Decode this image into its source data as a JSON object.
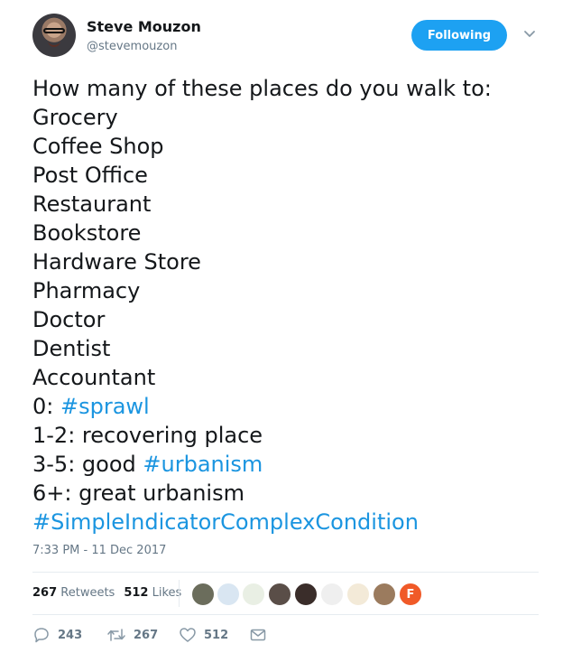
{
  "author": {
    "name": "Steve Mouzon",
    "handle": "@stevemouzon",
    "follow_label": "Following"
  },
  "tweet": {
    "lines": [
      {
        "text": "How many of these places do you walk to:"
      },
      {
        "text": "Grocery"
      },
      {
        "text": "Coffee Shop"
      },
      {
        "text": "Post Office"
      },
      {
        "text": "Restaurant"
      },
      {
        "text": "Bookstore"
      },
      {
        "text": "Hardware Store"
      },
      {
        "text": "Pharmacy"
      },
      {
        "text": "Doctor"
      },
      {
        "text": "Dentist"
      },
      {
        "text": "Accountant"
      },
      {
        "prefix": "0: ",
        "hashtag": "#sprawl"
      },
      {
        "text": "1-2: recovering place"
      },
      {
        "prefix": "3-5: good ",
        "hashtag": "#urbanism"
      },
      {
        "text": "6+: great urbanism"
      },
      {
        "prefix": "",
        "hashtag": "#SimpleIndicatorComplexCondition"
      }
    ],
    "timestamp": "7:33 PM - 11 Dec 2017"
  },
  "stats": {
    "retweets_count": "267",
    "retweets_label": "Retweets",
    "likes_count": "512",
    "likes_label": "Likes"
  },
  "liker_avatars": [
    {
      "color": "#6b6d5c"
    },
    {
      "color": "#d9e6f2"
    },
    {
      "color": "#e9efe4"
    },
    {
      "color": "#5a4e48"
    },
    {
      "color": "#3a2d2a"
    },
    {
      "color": "#efefef"
    },
    {
      "color": "#f3ead8"
    },
    {
      "color": "#9b7b5e"
    },
    {
      "color": "#f05a28"
    }
  ],
  "liker_last_letter": "F",
  "actions": {
    "reply_count": "243",
    "retweet_count": "267",
    "like_count": "512"
  },
  "colors": {
    "accent": "#1da1f2",
    "hashtag": "#1b95e0",
    "muted": "#657786"
  }
}
